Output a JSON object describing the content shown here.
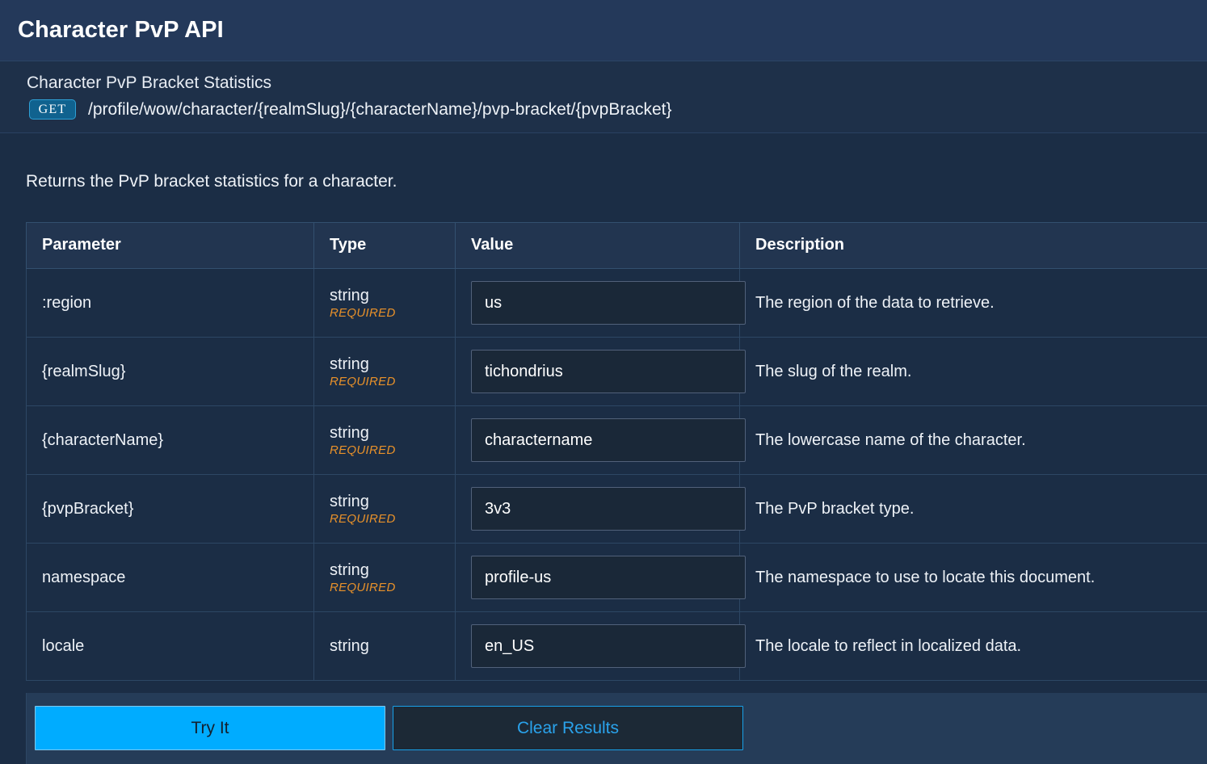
{
  "window": {
    "app_title": "Character PvP API"
  },
  "endpoint": {
    "title": "Character PvP Bracket Statistics",
    "method": "GET",
    "path": "/profile/wow/character/{realmSlug}/{characterName}/pvp-bracket/{pvpBracket}",
    "description": "Returns the PvP bracket statistics for a character."
  },
  "table": {
    "headers": {
      "parameter": "Parameter",
      "type": "Type",
      "value": "Value",
      "description": "Description"
    },
    "required_label": "REQUIRED",
    "rows": [
      {
        "parameter": ":region",
        "type": "string",
        "required": "REQUIRED",
        "value": "us",
        "description": "The region of the data to retrieve."
      },
      {
        "parameter": "{realmSlug}",
        "type": "string",
        "required": "REQUIRED",
        "value": "tichondrius",
        "description": "The slug of the realm."
      },
      {
        "parameter": "{characterName}",
        "type": "string",
        "required": "REQUIRED",
        "value": "charactername",
        "description": "The lowercase name of the character."
      },
      {
        "parameter": "{pvpBracket}",
        "type": "string",
        "required": "REQUIRED",
        "value": "3v3",
        "description": "The PvP bracket type."
      },
      {
        "parameter": "namespace",
        "type": "string",
        "required": "REQUIRED",
        "value": "profile-us",
        "description": "The namespace to use to locate this document."
      },
      {
        "parameter": "locale",
        "type": "string",
        "required": "",
        "value": "en_US",
        "description": "The locale to reflect in localized data."
      }
    ]
  },
  "actions": {
    "try_it": "Try It",
    "clear_results": "Clear Results"
  },
  "colors": {
    "accent": "#00acff",
    "method_badge_bg": "#10628f",
    "required": "#e8912a",
    "title_bar_bg": "#24395a",
    "body_bg": "#1b2d45"
  }
}
